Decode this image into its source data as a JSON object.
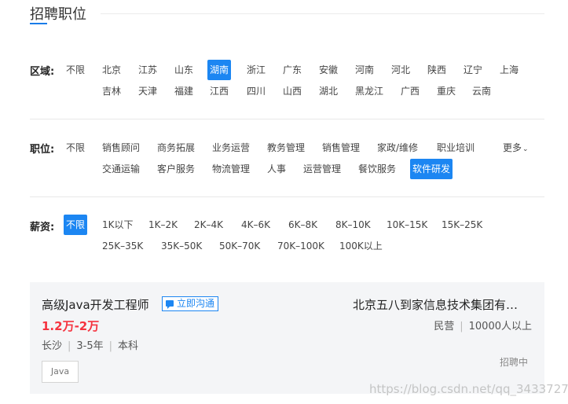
{
  "section": {
    "title": "招聘职位"
  },
  "region": {
    "label": "区域:",
    "options": [
      "不限",
      "北京",
      "江苏",
      "山东",
      "湖南",
      "浙江",
      "广东",
      "安徽",
      "河南",
      "河北",
      "陕西",
      "辽宁",
      "上海",
      "吉林",
      "天津",
      "福建",
      "江西",
      "四川",
      "山西",
      "湖北",
      "黑龙江",
      "广西",
      "重庆",
      "云南"
    ],
    "selected": "湖南"
  },
  "position": {
    "label": "职位:",
    "options": [
      "不限",
      "销售顾问",
      "商务拓展",
      "业务运营",
      "教务管理",
      "销售管理",
      "家政/维修",
      "职业培训",
      "交通运输",
      "客户服务",
      "物流管理",
      "人事",
      "运营管理",
      "餐饮服务",
      "软件研发"
    ],
    "more": "更多",
    "selected": "软件研发"
  },
  "salary": {
    "label": "薪资:",
    "options": [
      "不限",
      "1K以下",
      "1K–2K",
      "2K–4K",
      "4K–6K",
      "6K–8K",
      "8K–10K",
      "10K–15K",
      "15K–25K",
      "25K–35K",
      "35K–50K",
      "50K–70K",
      "70K–100K",
      "100K以上"
    ],
    "selected": "不限"
  },
  "job": {
    "title": "高级Java开发工程师",
    "chat": "立即沟通",
    "salary": "1.2万-2万",
    "city": "长沙",
    "experience": "3-5年",
    "education": "本科",
    "skill": "Java",
    "company": "北京五八到家信息技术集团有…",
    "company_type": "民营",
    "company_size": "10000人以上",
    "status": "招聘中"
  },
  "watermark": "https://blog.csdn.net/qq_34337272",
  "colors": {
    "accent": "#1c86f2",
    "salary": "#f5333f",
    "card_bg": "#f4f5f7"
  }
}
